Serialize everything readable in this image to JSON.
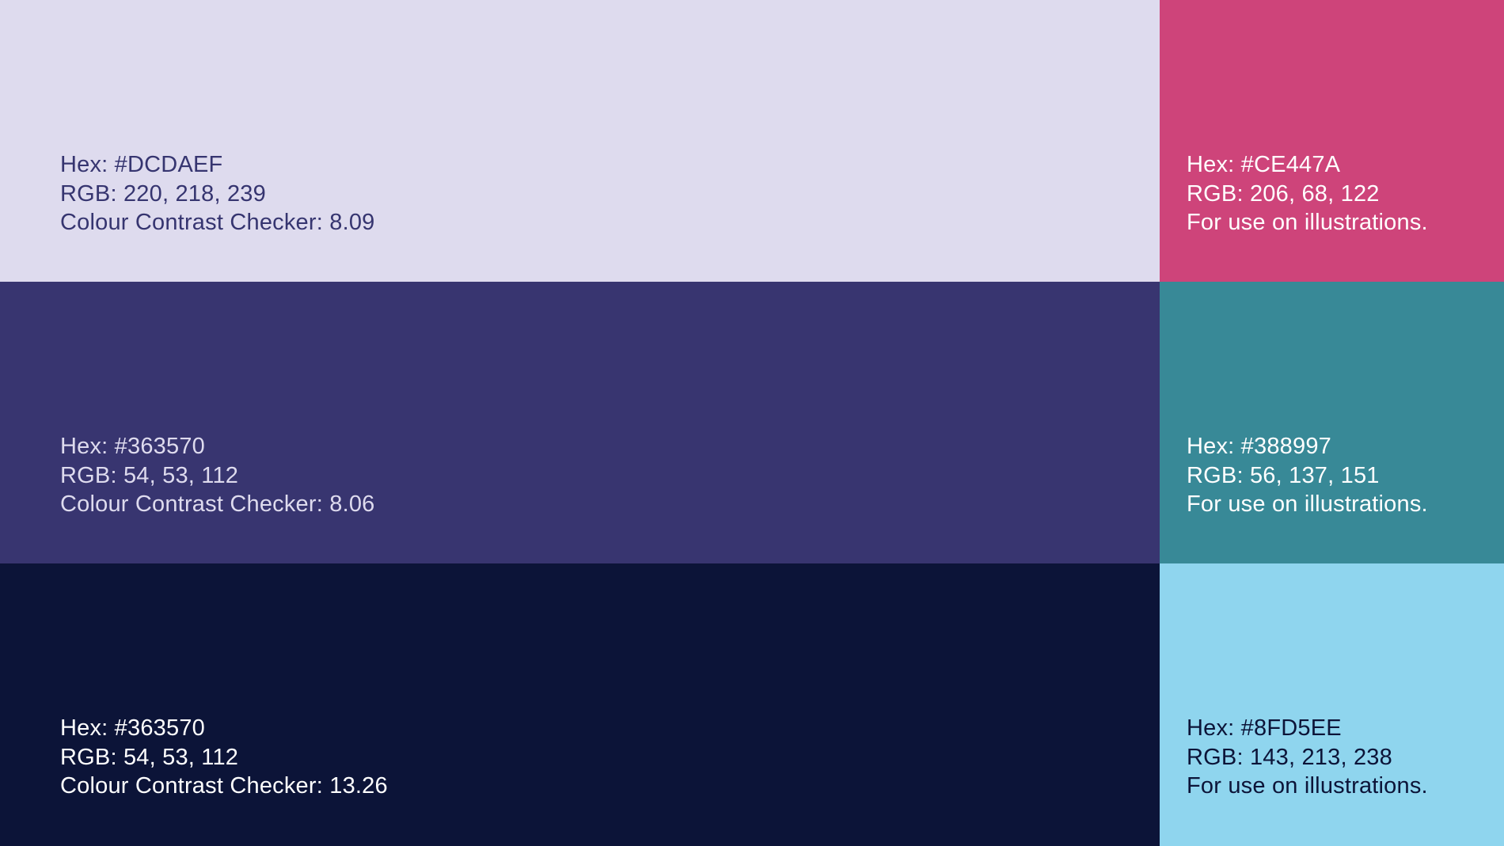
{
  "palette": {
    "swatches": [
      {
        "hex": "Hex: #DCDAEF",
        "rgb": "RGB: 220, 218, 239",
        "note": "Colour Contrast Checker: 8.09",
        "background": "#DEDBEE",
        "text_color": "#363570"
      },
      {
        "hex": "Hex: #CE447A",
        "rgb": "RGB: 206, 68, 122",
        "note": "For use on illustrations.",
        "background": "#CE447A",
        "text_color": "#FFFFFF"
      },
      {
        "hex": "Hex: #363570",
        "rgb": "RGB: 54, 53, 112",
        "note": "Colour Contrast Checker: 8.06",
        "background": "#383570",
        "text_color": "#DEDBEE"
      },
      {
        "hex": "Hex: #388997",
        "rgb": "RGB: 56, 137, 151",
        "note": "For use on illustrations.",
        "background": "#388997",
        "text_color": "#FFFFFF"
      },
      {
        "hex": "Hex: #363570",
        "rgb": "RGB: 54, 53, 112",
        "note": "Colour Contrast Checker: 13.26",
        "background": "#0C1438",
        "text_color": "#FFFFFF"
      },
      {
        "hex": "Hex: #8FD5EE",
        "rgb": "RGB: 143, 213, 238",
        "note": "For use on illustrations.",
        "background": "#8FD5EE",
        "text_color": "#0C1438"
      }
    ]
  }
}
